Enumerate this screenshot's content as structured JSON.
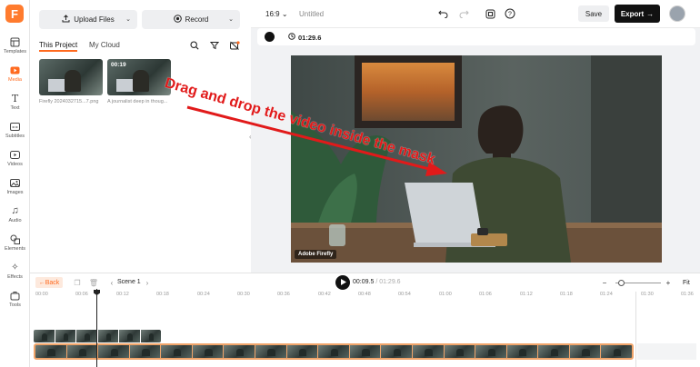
{
  "app": {
    "logo_letter": "F"
  },
  "rail": {
    "items": [
      {
        "label": "Templates",
        "icon": "templates-icon"
      },
      {
        "label": "Media",
        "icon": "media-icon",
        "active": true
      },
      {
        "label": "Text",
        "icon": "text-icon"
      },
      {
        "label": "Subtitles",
        "icon": "subtitles-icon"
      },
      {
        "label": "Videos",
        "icon": "videos-icon"
      },
      {
        "label": "Images",
        "icon": "images-icon"
      },
      {
        "label": "Audio",
        "icon": "audio-icon"
      },
      {
        "label": "Elements",
        "icon": "elements-icon"
      },
      {
        "label": "Effects",
        "icon": "effects-icon"
      },
      {
        "label": "Tools",
        "icon": "tools-icon"
      }
    ]
  },
  "panel": {
    "upload_label": "Upload Files",
    "record_label": "Record",
    "tab_project": "This Project",
    "tab_cloud": "My Cloud",
    "thumbs": [
      {
        "caption": "Firefly 2024032715...7.png",
        "duration": ""
      },
      {
        "caption": "A journalist deep in thoug...",
        "duration": "00:19"
      }
    ]
  },
  "topbar": {
    "ratio": "16:9",
    "title": "Untitled",
    "save_label": "Save",
    "export_label": "Export"
  },
  "subbar": {
    "timecode": "01:29.6"
  },
  "canvas": {
    "badge": "Adobe Firefly",
    "annotation": "Drag and drop the video inside the mask",
    "accent": "#e11a1a"
  },
  "timeline": {
    "back_label": "Back",
    "scene_label": "Scene 1",
    "current_time": "00:09.5",
    "total_time": "/ 01:29.6",
    "fit_label": "Fit",
    "ticks": [
      "00:00",
      "00:06",
      "00:12",
      "00:18",
      "00:24",
      "00:30",
      "00:36",
      "00:42",
      "00:48",
      "00:54",
      "01:00",
      "01:06",
      "01:12",
      "01:18",
      "01:24",
      "01:30",
      "01:36"
    ]
  },
  "colors": {
    "brand": "#ff6a1f",
    "clip_border": "#f0a46a"
  }
}
